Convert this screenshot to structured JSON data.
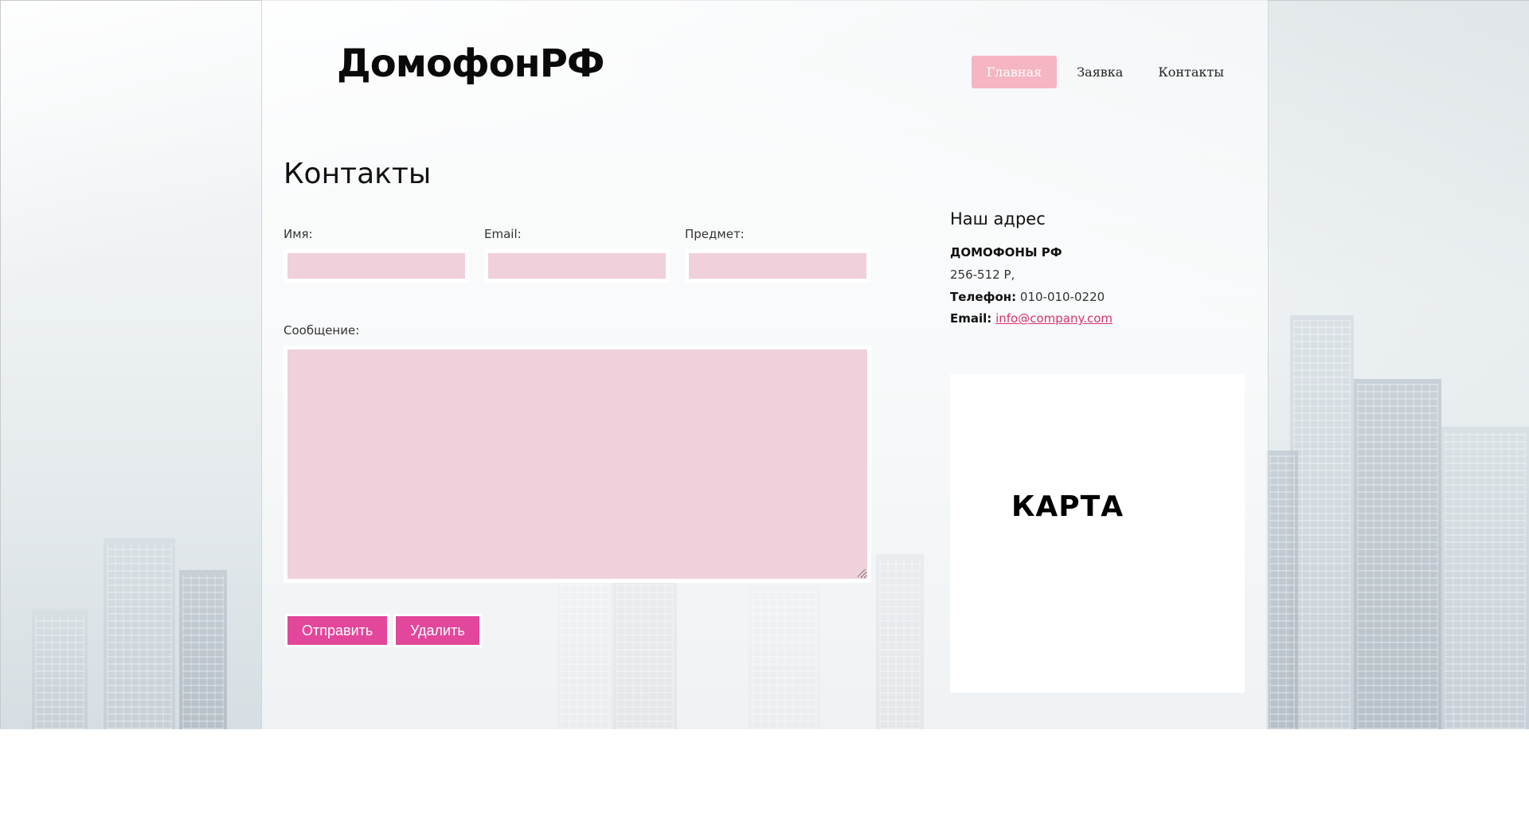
{
  "brand": {
    "logo_text": "ДомофонРФ"
  },
  "nav": {
    "items": [
      {
        "label": "Главная",
        "active": true
      },
      {
        "label": "Заявка",
        "active": false
      },
      {
        "label": "Контакты",
        "active": false
      }
    ]
  },
  "page": {
    "title": "Контакты"
  },
  "form": {
    "name_label": "Имя:",
    "name_value": "",
    "email_label": "Email:",
    "email_value": "",
    "subject_label": "Предмет:",
    "subject_value": "",
    "message_label": "Сообщение:",
    "message_value": "",
    "submit_label": "Отправить",
    "delete_label": "Удалить"
  },
  "address": {
    "title": "Наш адрес",
    "company": "ДОМОФОНЫ РФ",
    "street": "256-512 Р,",
    "phone_label": "Телефон:",
    "phone_value": "010-010-0220",
    "email_label": "Email:",
    "email_value": "info@company.com"
  },
  "map": {
    "label": "КАРТА"
  },
  "colors": {
    "accent": "#e2479b",
    "nav_active_bg": "#f5b5c2",
    "input_bg": "#f0d0da",
    "link": "#d6336c"
  }
}
